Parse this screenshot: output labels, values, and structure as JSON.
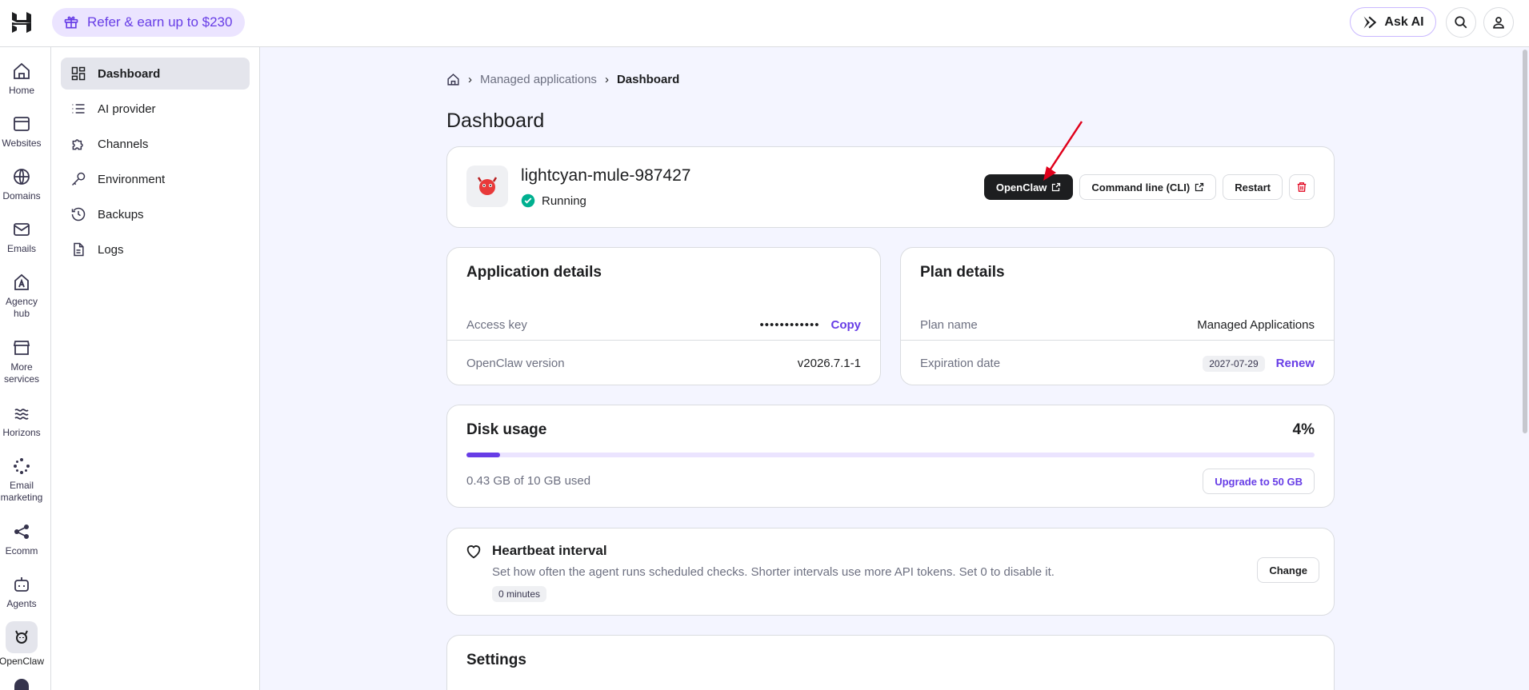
{
  "topbar": {
    "refer_label": "Refer & earn up to $230",
    "askai_label": "Ask AI"
  },
  "rail": [
    {
      "label": "Home",
      "icon": "home-icon"
    },
    {
      "label": "Websites",
      "icon": "browser-icon"
    },
    {
      "label": "Domains",
      "icon": "globe-icon"
    },
    {
      "label": "Emails",
      "icon": "mail-icon"
    },
    {
      "label": "Agency hub",
      "icon": "agency-icon"
    },
    {
      "label": "More services",
      "icon": "store-icon"
    },
    {
      "label": "Horizons",
      "icon": "horizons-icon"
    },
    {
      "label": "Email marketing",
      "icon": "sparkle-icon"
    },
    {
      "label": "Ecomm",
      "icon": "share-icon"
    },
    {
      "label": "Agents",
      "icon": "robot-icon"
    },
    {
      "label": "OpenClaw",
      "icon": "openclaw-icon"
    }
  ],
  "subnav": [
    {
      "label": "Dashboard",
      "active": true
    },
    {
      "label": "AI provider"
    },
    {
      "label": "Channels"
    },
    {
      "label": "Environment"
    },
    {
      "label": "Backups"
    },
    {
      "label": "Logs"
    }
  ],
  "breadcrumb": {
    "parent": "Managed applications",
    "current": "Dashboard"
  },
  "page_title": "Dashboard",
  "app": {
    "name": "lightcyan-mule-987427",
    "status": "Running",
    "buttons": {
      "open": "OpenClaw",
      "cli": "Command line (CLI)",
      "restart": "Restart"
    }
  },
  "app_details": {
    "title": "Application details",
    "access_key_label": "Access key",
    "access_key_value": "••••••••••••",
    "copy_label": "Copy",
    "version_label": "OpenClaw version",
    "version_value": "v2026.7.1-1"
  },
  "plan_details": {
    "title": "Plan details",
    "plan_name_label": "Plan name",
    "plan_name_value": "Managed Applications",
    "expiration_label": "Expiration date",
    "expiration_value": "2027-07-29",
    "renew_label": "Renew"
  },
  "disk": {
    "title": "Disk usage",
    "percent_label": "4%",
    "fraction": 0.04,
    "used_text": "0.43 GB of 10 GB used",
    "upgrade_label": "Upgrade to 50 GB"
  },
  "heartbeat": {
    "title": "Heartbeat interval",
    "description": "Set how often the agent runs scheduled checks. Shorter intervals use more API tokens. Set 0 to disable it.",
    "value": "0 minutes",
    "change_label": "Change"
  },
  "settings": {
    "title": "Settings"
  },
  "colors": {
    "accent": "#673de6",
    "running": "#00b090",
    "danger": "#fc5185",
    "arrow": "#e0001b"
  }
}
